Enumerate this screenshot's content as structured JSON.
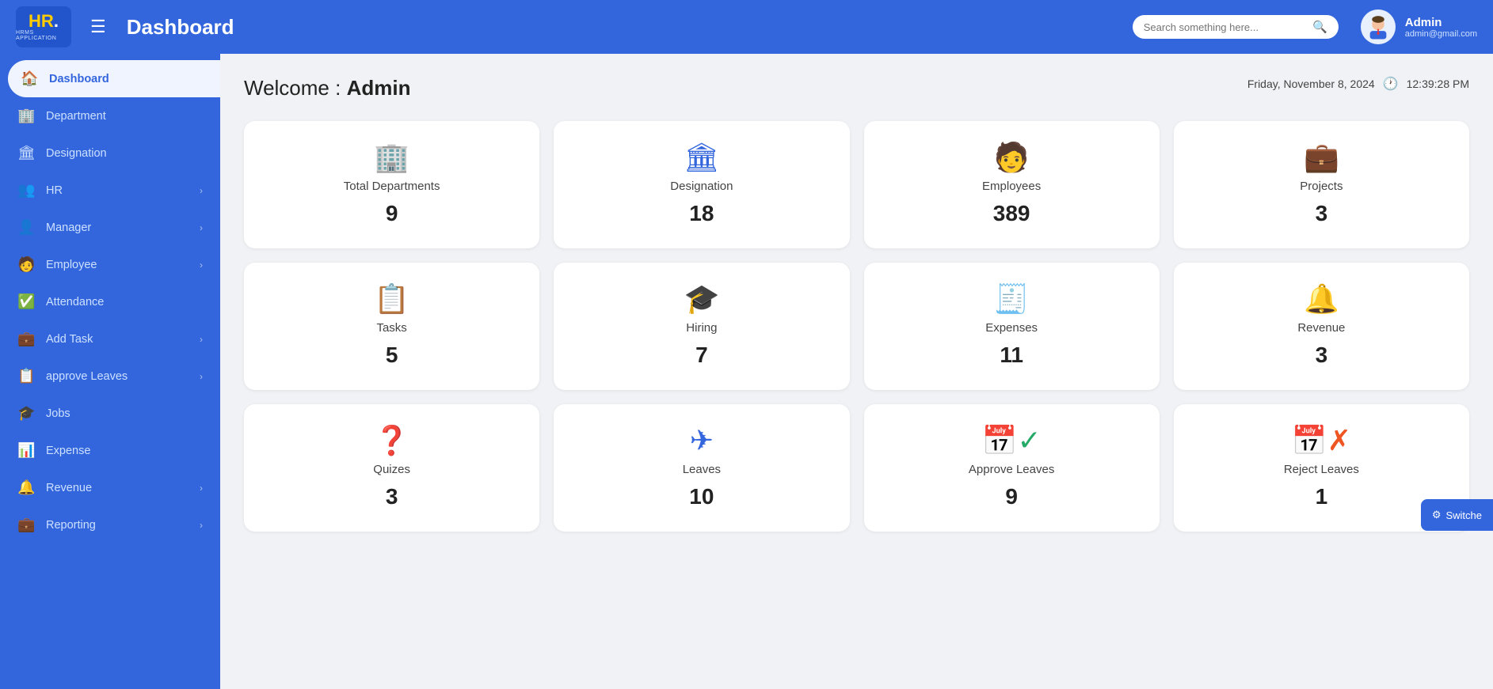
{
  "topnav": {
    "logo_hr": "HR.",
    "logo_sub": "HRMS APPLICATION",
    "hamburger": "☰",
    "title": "Dashboard",
    "search_placeholder": "Search something here...",
    "user_name": "Admin",
    "user_email": "admin@gmail.com"
  },
  "datetime": {
    "date": "Friday, November 8, 2024",
    "time": "12:39:28 PM"
  },
  "welcome": {
    "prefix": "Welcome : ",
    "name": "Admin"
  },
  "sidebar": {
    "items": [
      {
        "id": "dashboard",
        "label": "Dashboard",
        "icon": "🏠",
        "active": true,
        "arrow": false
      },
      {
        "id": "department",
        "label": "Department",
        "icon": "🏢",
        "active": false,
        "arrow": false
      },
      {
        "id": "designation",
        "label": "Designation",
        "icon": "🏛",
        "active": false,
        "arrow": false
      },
      {
        "id": "hr",
        "label": "HR",
        "icon": "👥",
        "active": false,
        "arrow": true
      },
      {
        "id": "manager",
        "label": "Manager",
        "icon": "👤",
        "active": false,
        "arrow": true
      },
      {
        "id": "employee",
        "label": "Employee",
        "icon": "🧑",
        "active": false,
        "arrow": true
      },
      {
        "id": "attendance",
        "label": "Attendance",
        "icon": "✅",
        "active": false,
        "arrow": false
      },
      {
        "id": "addtask",
        "label": "Add Task",
        "icon": "💼",
        "active": false,
        "arrow": true
      },
      {
        "id": "approveleaves",
        "label": "approve Leaves",
        "icon": "📋",
        "active": false,
        "arrow": true
      },
      {
        "id": "jobs",
        "label": "Jobs",
        "icon": "🎓",
        "active": false,
        "arrow": false
      },
      {
        "id": "expense",
        "label": "Expense",
        "icon": "📊",
        "active": false,
        "arrow": false
      },
      {
        "id": "revenue",
        "label": "Revenue",
        "icon": "🔔",
        "active": false,
        "arrow": true
      },
      {
        "id": "reporting",
        "label": "Reporting",
        "icon": "💼",
        "active": false,
        "arrow": true
      }
    ]
  },
  "cards_row1": [
    {
      "id": "total-departments",
      "label": "Total Departments",
      "value": "9",
      "icon": "🏢",
      "icon_color": "blue"
    },
    {
      "id": "designation",
      "label": "Designation",
      "value": "18",
      "icon": "🏛",
      "icon_color": "blue"
    },
    {
      "id": "employees",
      "label": "Employees",
      "value": "389",
      "icon": "🧑",
      "icon_color": "green"
    },
    {
      "id": "projects",
      "label": "Projects",
      "value": "3",
      "icon": "💼",
      "icon_color": "blue"
    }
  ],
  "cards_row2": [
    {
      "id": "tasks",
      "label": "Tasks",
      "value": "5",
      "icon": "📋",
      "icon_color": "blue"
    },
    {
      "id": "hiring",
      "label": "Hiring",
      "value": "7",
      "icon": "🎓",
      "icon_color": "blue"
    },
    {
      "id": "expenses",
      "label": "Expenses",
      "value": "11",
      "icon": "🧾",
      "icon_color": "orange"
    },
    {
      "id": "revenue",
      "label": "Revenue",
      "value": "3",
      "icon": "🔔",
      "icon_color": "gray"
    }
  ],
  "cards_row3": [
    {
      "id": "quizes",
      "label": "Quizes",
      "value": "3",
      "icon": "❓",
      "icon_color": "gray"
    },
    {
      "id": "leaves",
      "label": "Leaves",
      "value": "10",
      "icon": "✈",
      "icon_color": "blue"
    },
    {
      "id": "approve-leaves",
      "label": "Approve Leaves",
      "value": "9",
      "icon": "📅✓",
      "icon_color": "green"
    },
    {
      "id": "reject-leaves",
      "label": "Reject Leaves",
      "value": "1",
      "icon": "📅✗",
      "icon_color": "orange"
    }
  ],
  "switch_btn": {
    "label": "Switche",
    "icon": "⚙"
  }
}
